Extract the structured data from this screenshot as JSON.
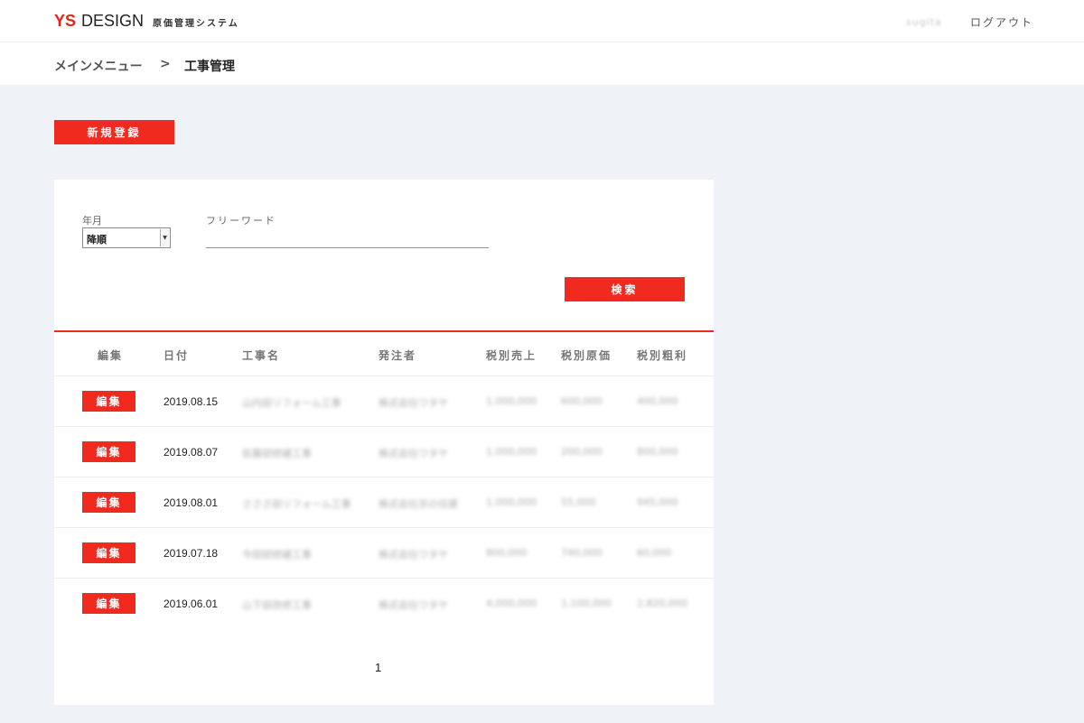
{
  "header": {
    "logo_ys": "YS",
    "logo_design": "DESIGN",
    "logo_sub": "原価管理システム",
    "user_name": "sugita",
    "logout": "ログアウト"
  },
  "breadcrumb": {
    "home": "メインメニュー",
    "separator": ">",
    "current": "工事管理"
  },
  "new_button": "新規登録",
  "filters": {
    "year_month_label": "年月",
    "year_month_value": "降順",
    "freeword_label": "フリーワード",
    "freeword_value": "",
    "search_button": "検索"
  },
  "table": {
    "headers": [
      "編集",
      "日付",
      "工事名",
      "発注者",
      "税別売上",
      "税別原価",
      "税別粗利"
    ],
    "edit_label": "編集",
    "rows": [
      {
        "date": "2019.08.15",
        "name": "山内邸リフォーム工事",
        "client": "株式会社ワタヤ",
        "sales": "1,000,000",
        "cost": "600,000",
        "profit": "400,000"
      },
      {
        "date": "2019.08.07",
        "name": "佐藤邸修繕工事",
        "client": "株式会社ワタヤ",
        "sales": "1,000,000",
        "cost": "200,000",
        "profit": "800,000"
      },
      {
        "date": "2019.08.01",
        "name": "さささ邸リフォーム工事",
        "client": "株式会社京の住建",
        "sales": "1,000,000",
        "cost": "55,000",
        "profit": "945,000"
      },
      {
        "date": "2019.07.18",
        "name": "今田邸修繕工事",
        "client": "株式会社ワタヤ",
        "sales": "800,000",
        "cost": "740,000",
        "profit": "60,000"
      },
      {
        "date": "2019.06.01",
        "name": "山下邸改修工事",
        "client": "株式会社ワタヤ",
        "sales": "4,000,000",
        "cost": "1,100,000",
        "profit": "2,820,000"
      }
    ]
  },
  "pagination": {
    "current_page": "1"
  }
}
